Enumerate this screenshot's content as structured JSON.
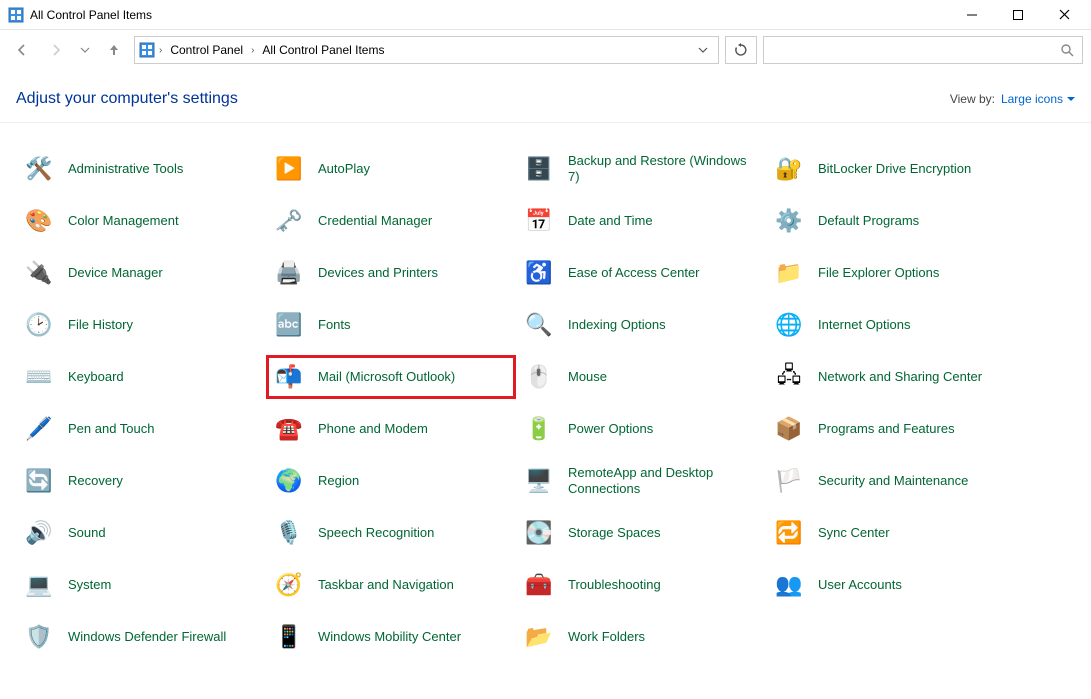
{
  "window": {
    "title": "All Control Panel Items"
  },
  "breadcrumb": {
    "items": [
      "Control Panel",
      "All Control Panel Items"
    ]
  },
  "header": {
    "adjust_label": "Adjust your computer's settings",
    "view_by_label": "View by:",
    "view_by_value": "Large icons"
  },
  "items": [
    {
      "label": "Administrative Tools",
      "icon": "🛠️"
    },
    {
      "label": "AutoPlay",
      "icon": "▶️"
    },
    {
      "label": "Backup and Restore (Windows 7)",
      "icon": "🗄️"
    },
    {
      "label": "BitLocker Drive Encryption",
      "icon": "🔐"
    },
    {
      "label": "Color Management",
      "icon": "🎨"
    },
    {
      "label": "Credential Manager",
      "icon": "🗝️"
    },
    {
      "label": "Date and Time",
      "icon": "📅"
    },
    {
      "label": "Default Programs",
      "icon": "⚙️"
    },
    {
      "label": "Device Manager",
      "icon": "🔌"
    },
    {
      "label": "Devices and Printers",
      "icon": "🖨️"
    },
    {
      "label": "Ease of Access Center",
      "icon": "♿"
    },
    {
      "label": "File Explorer Options",
      "icon": "📁"
    },
    {
      "label": "File History",
      "icon": "🕑"
    },
    {
      "label": "Fonts",
      "icon": "🔤"
    },
    {
      "label": "Indexing Options",
      "icon": "🔍"
    },
    {
      "label": "Internet Options",
      "icon": "🌐"
    },
    {
      "label": "Keyboard",
      "icon": "⌨️"
    },
    {
      "label": "Mail (Microsoft Outlook)",
      "icon": "📬",
      "highlighted": true
    },
    {
      "label": "Mouse",
      "icon": "🖱️"
    },
    {
      "label": "Network and Sharing Center",
      "icon": "🖧"
    },
    {
      "label": "Pen and Touch",
      "icon": "🖊️"
    },
    {
      "label": "Phone and Modem",
      "icon": "☎️"
    },
    {
      "label": "Power Options",
      "icon": "🔋"
    },
    {
      "label": "Programs and Features",
      "icon": "📦"
    },
    {
      "label": "Recovery",
      "icon": "🔄"
    },
    {
      "label": "Region",
      "icon": "🌍"
    },
    {
      "label": "RemoteApp and Desktop Connections",
      "icon": "🖥️"
    },
    {
      "label": "Security and Maintenance",
      "icon": "🏳️"
    },
    {
      "label": "Sound",
      "icon": "🔊"
    },
    {
      "label": "Speech Recognition",
      "icon": "🎙️"
    },
    {
      "label": "Storage Spaces",
      "icon": "💽"
    },
    {
      "label": "Sync Center",
      "icon": "🔁"
    },
    {
      "label": "System",
      "icon": "💻"
    },
    {
      "label": "Taskbar and Navigation",
      "icon": "🧭"
    },
    {
      "label": "Troubleshooting",
      "icon": "🧰"
    },
    {
      "label": "User Accounts",
      "icon": "👥"
    },
    {
      "label": "Windows Defender Firewall",
      "icon": "🛡️"
    },
    {
      "label": "Windows Mobility Center",
      "icon": "📱"
    },
    {
      "label": "Work Folders",
      "icon": "📂"
    }
  ]
}
